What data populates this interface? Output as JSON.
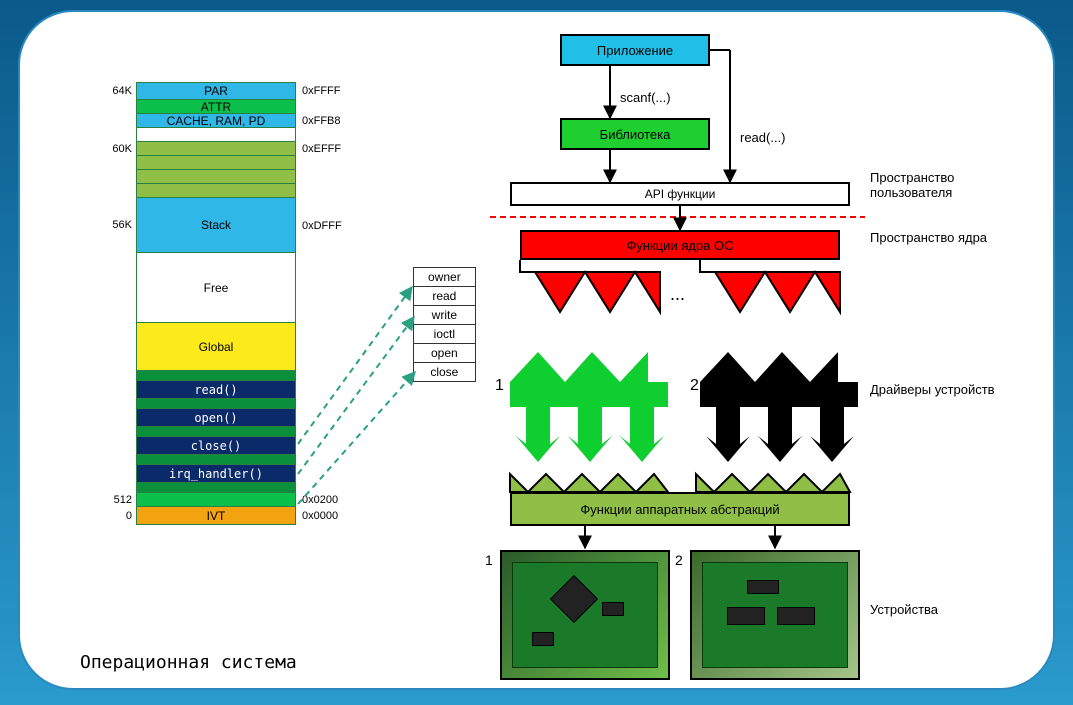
{
  "title": "Операционная система",
  "memory_map": {
    "left_labels": [
      "64K",
      "",
      "",
      "",
      "60K",
      "",
      "",
      "",
      "56K",
      "",
      "",
      "",
      "",
      "",
      "",
      "",
      "",
      "",
      "",
      "",
      "512",
      "0"
    ],
    "cells": [
      {
        "text": "PAR",
        "cls": "c-blue",
        "h": "med"
      },
      {
        "text": "ATTR",
        "cls": "c-green",
        "h": "thin"
      },
      {
        "text": "CACHE, RAM, PD",
        "cls": "c-blue",
        "h": "thin"
      },
      {
        "text": "",
        "cls": "c-white",
        "h": "thin"
      },
      {
        "text": "",
        "cls": "c-lgreen",
        "h": "thin"
      },
      {
        "text": "",
        "cls": "c-lgreen",
        "h": "thin"
      },
      {
        "text": "",
        "cls": "c-lgreen",
        "h": "thin"
      },
      {
        "text": "",
        "cls": "c-lgreen",
        "h": "thin"
      },
      {
        "text": "Stack",
        "cls": "c-blue",
        "h": "stack"
      },
      {
        "text": "Free",
        "cls": "c-white",
        "h": "free"
      },
      {
        "text": "Global",
        "cls": "c-yellow",
        "h": "tall"
      },
      {
        "text": "",
        "cls": "c-dgreen",
        "h": "bar"
      },
      {
        "text": "read()",
        "cls": "c-navy",
        "h": "med"
      },
      {
        "text": "",
        "cls": "c-dgreen",
        "h": "bar"
      },
      {
        "text": "open()",
        "cls": "c-navy",
        "h": "med"
      },
      {
        "text": "",
        "cls": "c-dgreen",
        "h": "bar"
      },
      {
        "text": "close()",
        "cls": "c-navy",
        "h": "med"
      },
      {
        "text": "",
        "cls": "c-dgreen",
        "h": "bar"
      },
      {
        "text": "irq_handler()",
        "cls": "c-navy",
        "h": "med"
      },
      {
        "text": "",
        "cls": "c-dgreen",
        "h": "bar"
      },
      {
        "text": "",
        "cls": "c-green",
        "h": "thin"
      },
      {
        "text": "IVT",
        "cls": "c-orange",
        "h": "med"
      }
    ],
    "right_labels": [
      "0xFFFF",
      "",
      "0xFFB8",
      "",
      "0xEFFF",
      "",
      "",
      "",
      "0xDFFF",
      "",
      "",
      "",
      "",
      "",
      "",
      "",
      "",
      "",
      "",
      "",
      "0x0200",
      "0x0000"
    ]
  },
  "struct_fields": [
    "owner",
    "read",
    "write",
    "ioctl",
    "open",
    "close"
  ],
  "layers": {
    "app": "Приложение",
    "scanf": "scanf(...)",
    "lib": "Библиотека",
    "read": "read(...)",
    "api": "API функции",
    "kernel": "Функции ядра ОС",
    "ellipsis": "...",
    "drv1": "1",
    "drv2": "2",
    "hal": "Функции аппаратных абстракций",
    "dev1": "1",
    "dev2": "2"
  },
  "side_labels": {
    "user": "Пространство пользователя",
    "kernel": "Пространство ядра",
    "drivers": "Драйверы устройств",
    "devices": "Устройства"
  }
}
